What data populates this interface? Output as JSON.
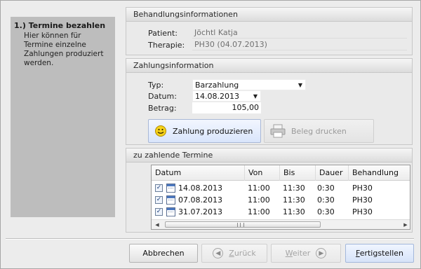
{
  "step": {
    "title": "1.) Termine bezahlen",
    "description": "Hier können für Termine einzelne Zahlungen produziert werden."
  },
  "behandlung": {
    "header": "Behandlungsinformationen",
    "patient_label": "Patient:",
    "patient_value": "Jöchtl Katja",
    "therapie_label": "Therapie:",
    "therapie_value": "PH30 (04.07.2013)"
  },
  "zahlung": {
    "header": "Zahlungsinformation",
    "typ_label": "Typ:",
    "typ_value": "Barzahlung",
    "datum_label": "Datum:",
    "datum_value": "14.08.2013",
    "betrag_label": "Betrag:",
    "betrag_value": "105,00",
    "produce_label": "Zahlung produzieren",
    "print_label": "Beleg drucken"
  },
  "termine": {
    "header": "zu zahlende Termine",
    "columns": [
      "Datum",
      "Von",
      "Bis",
      "Dauer",
      "Behandlung"
    ],
    "rows": [
      {
        "checked": true,
        "datum": "14.08.2013",
        "von": "11:00",
        "bis": "11:30",
        "dauer": "0:30",
        "behandlung": "PH30"
      },
      {
        "checked": true,
        "datum": "07.08.2013",
        "von": "11:00",
        "bis": "11:30",
        "dauer": "0:30",
        "behandlung": "PH30"
      },
      {
        "checked": true,
        "datum": "31.07.2013",
        "von": "11:00",
        "bis": "11:30",
        "dauer": "0:30",
        "behandlung": "PH30"
      }
    ]
  },
  "footer": {
    "cancel_label": "Abbrechen",
    "back_label": "Zurück",
    "next_label": "Weiter",
    "finish_label": "Fertigstellen"
  },
  "colors": {
    "accent_border": "#a9b8d6",
    "step_panel_bg": "#bdbdbd"
  },
  "icons": {
    "produce": "smiley-icon",
    "print": "printer-icon",
    "back": "arrow-left-icon",
    "next": "arrow-right-icon",
    "calendar": "calendar-icon",
    "checkbox": "checkmark-icon"
  }
}
